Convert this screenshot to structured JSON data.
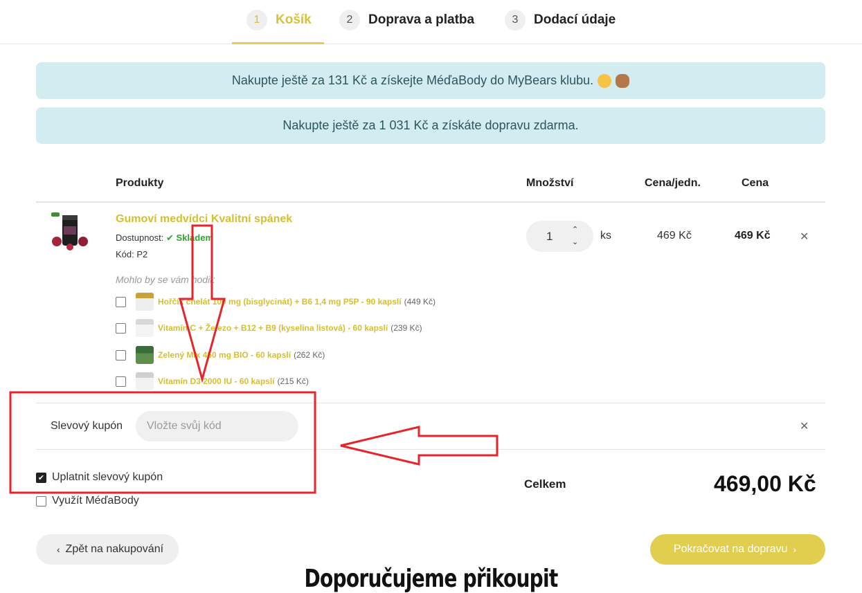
{
  "steps": [
    {
      "num": "1",
      "label": "Košík"
    },
    {
      "num": "2",
      "label": "Doprava a platba"
    },
    {
      "num": "3",
      "label": "Dodací údaje"
    }
  ],
  "banners": {
    "club": "Nakupte ještě za 131 Kč a získejte MéďaBody do MyBears klubu.",
    "shipping": "Nakupte ještě za 1 031 Kč a získáte dopravu zdarma."
  },
  "table": {
    "col_products": "Produkty",
    "col_qty": "Množství",
    "col_unit_price": "Cena/jedn.",
    "col_price": "Cena"
  },
  "product": {
    "name": "Gumoví medvídci Kvalitní spánek",
    "availability_label": "Dostupnost:",
    "availability_value": "Skladem",
    "code_text": "Kód: P2",
    "qty": "1",
    "unit": "ks",
    "unit_price": "469 Kč",
    "price": "469 Kč"
  },
  "suggestions": {
    "title": "Mohlo by se vám hodit:",
    "items": [
      {
        "name": "Hořčík chelát 100 mg (bisglycinát) + B6 1,4 mg P5P - 90 kapslí",
        "price": "(449 Kč)"
      },
      {
        "name": "Vitamín C + Železo + B12 + B9 (kyselina listová) - 60 kapslí",
        "price": "(239 Kč)"
      },
      {
        "name": "Zelený Mix 450 mg BIO - 60 kapslí",
        "price": "(262 Kč)"
      },
      {
        "name": "Vitamín D3 2000 IU - 60 kapslí",
        "price": "(215 Kč)"
      }
    ]
  },
  "coupon": {
    "label": "Slevový kupón",
    "placeholder": "Vložte svůj kód"
  },
  "options": {
    "apply_coupon": "Uplatnit slevový kupón",
    "use_medabody": "Využít MéďaBody"
  },
  "total": {
    "label": "Celkem",
    "value": "469,00 Kč"
  },
  "buttons": {
    "back": "Zpět na nakupování",
    "next": "Pokračovat na dopravu"
  },
  "recommend_title": "Doporučujeme přikoupit",
  "colors": {
    "accent": "#e1cd4e",
    "banner_bg": "#d3ecf0",
    "annotation_red": "#e8232a",
    "in_stock": "#2ea52e"
  }
}
